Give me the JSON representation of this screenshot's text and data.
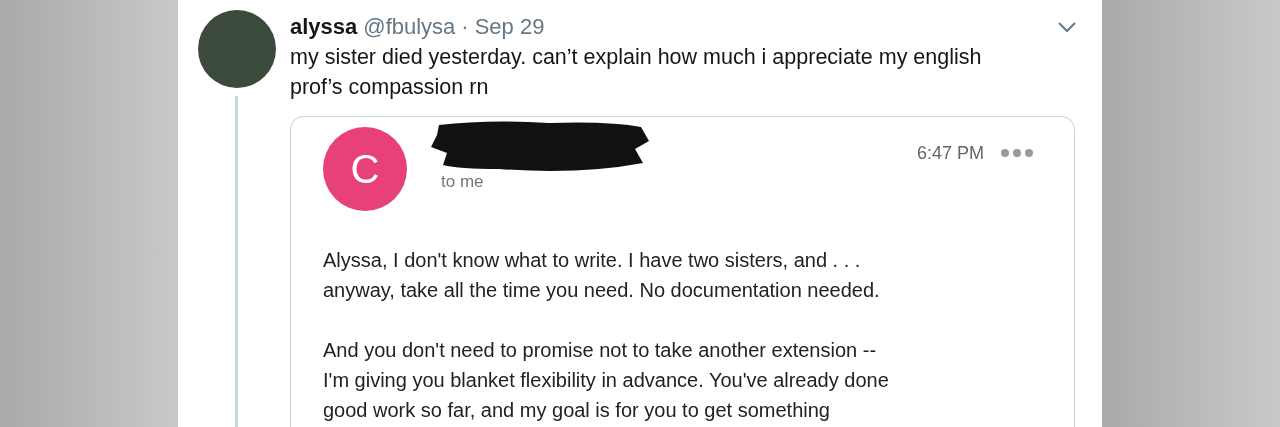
{
  "tweet": {
    "name": "alyssa",
    "handle": "@fbulysa",
    "separator": "·",
    "date": "Sep 29",
    "text_lines": [
      "my sister died yesterday. can’t explain how much i appreciate my english",
      "prof’s compassion rn"
    ]
  },
  "email": {
    "avatar_letter": "C",
    "recipient": "to me",
    "time": "6:47 PM",
    "paragraphs": [
      [
        "Alyssa, I don't know what to write. I have two sisters, and . . .",
        "anyway, take all the time you need. No documentation needed."
      ],
      [
        "And you don't need to promise not to take another extension --",
        "I'm giving you blanket flexibility in advance. You've already done",
        "good work so far, and my goal is for you to get something"
      ]
    ]
  }
}
